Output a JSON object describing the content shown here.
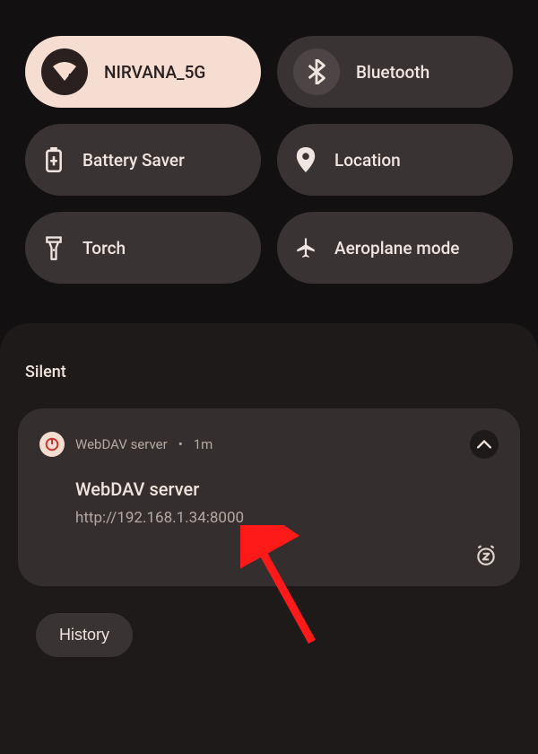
{
  "quick_settings": {
    "wifi": {
      "label": "NIRVANA_5G",
      "signal": "5"
    },
    "bluetooth": {
      "label": "Bluetooth"
    },
    "battery_saver": {
      "label": "Battery Saver"
    },
    "location": {
      "label": "Location"
    },
    "torch": {
      "label": "Torch"
    },
    "aeroplane": {
      "label": "Aeroplane mode"
    }
  },
  "notifications": {
    "section_header": "Silent",
    "card": {
      "app_name": "WebDAV server",
      "time": "1m",
      "title": "WebDAV server",
      "text": "http://192.168.1.34:8000"
    }
  },
  "history_label": "History"
}
